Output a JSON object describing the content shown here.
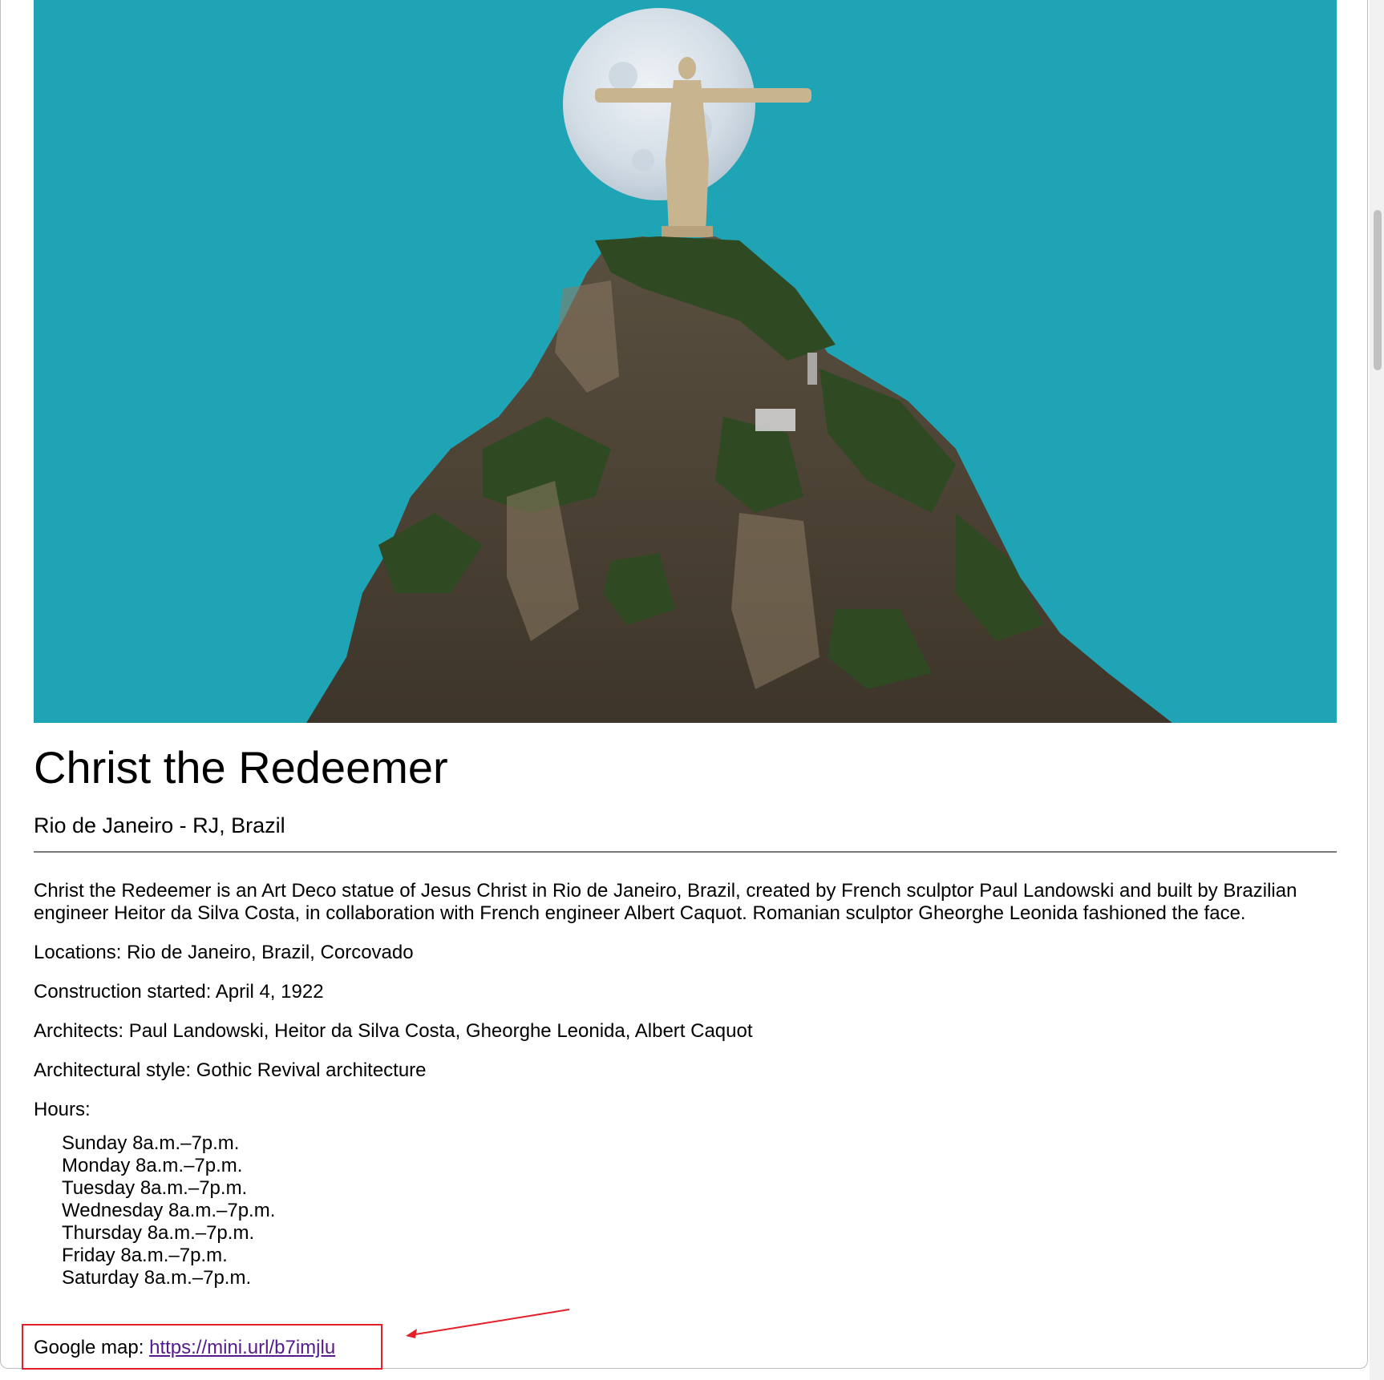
{
  "place": {
    "title": "Christ the Redeemer",
    "subtitle": "Rio de Janeiro - RJ, Brazil"
  },
  "description": "Christ the Redeemer is an Art Deco statue of Jesus Christ in Rio de Janeiro, Brazil, created by French sculptor Paul Landowski and built by Brazilian engineer Heitor da Silva Costa, in collaboration with French engineer Albert Caquot. Romanian sculptor Gheorghe Leonida fashioned the face.",
  "details": {
    "locations": "Locations: Rio de Janeiro, Brazil, Corcovado",
    "construction": "Construction started: April 4, 1922",
    "architects": "Architects: Paul Landowski, Heitor da Silva Costa, Gheorghe Leonida, Albert Caquot",
    "style": "Architectural style: Gothic Revival architecture",
    "hours_label": "Hours:"
  },
  "hours": [
    "Sunday 8a.m.–7p.m.",
    "Monday 8a.m.–7p.m.",
    "Tuesday 8a.m.–7p.m.",
    "Wednesday 8a.m.–7p.m.",
    "Thursday 8a.m.–7p.m.",
    "Friday 8a.m.–7p.m.",
    "Saturday 8a.m.–7p.m."
  ],
  "map": {
    "label": "Google map: ",
    "link_text": "https://mini.url/b7imjlu"
  },
  "colors": {
    "sky": "#1fa4b5",
    "annotation": "#e3202a",
    "link_visited": "#551a8b"
  }
}
